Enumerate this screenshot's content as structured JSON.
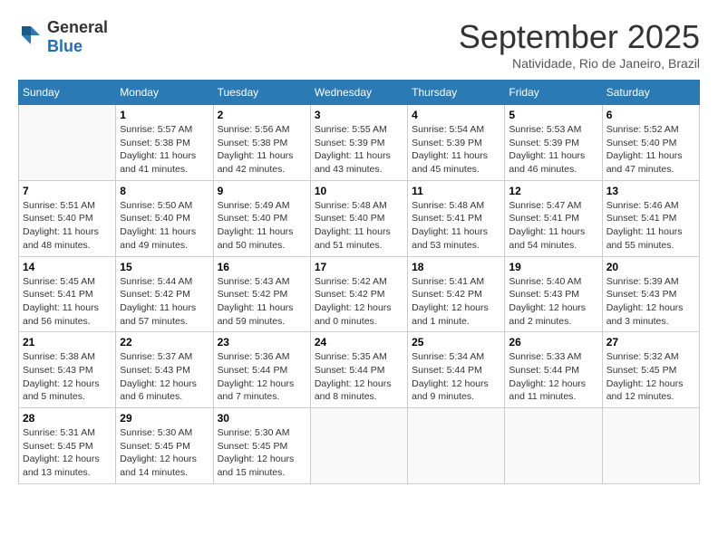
{
  "logo": {
    "general": "General",
    "blue": "Blue"
  },
  "header": {
    "month": "September 2025",
    "location": "Natividade, Rio de Janeiro, Brazil"
  },
  "weekdays": [
    "Sunday",
    "Monday",
    "Tuesday",
    "Wednesday",
    "Thursday",
    "Friday",
    "Saturday"
  ],
  "weeks": [
    [
      {
        "day": "",
        "info": ""
      },
      {
        "day": "1",
        "info": "Sunrise: 5:57 AM\nSunset: 5:38 PM\nDaylight: 11 hours\nand 41 minutes."
      },
      {
        "day": "2",
        "info": "Sunrise: 5:56 AM\nSunset: 5:38 PM\nDaylight: 11 hours\nand 42 minutes."
      },
      {
        "day": "3",
        "info": "Sunrise: 5:55 AM\nSunset: 5:39 PM\nDaylight: 11 hours\nand 43 minutes."
      },
      {
        "day": "4",
        "info": "Sunrise: 5:54 AM\nSunset: 5:39 PM\nDaylight: 11 hours\nand 45 minutes."
      },
      {
        "day": "5",
        "info": "Sunrise: 5:53 AM\nSunset: 5:39 PM\nDaylight: 11 hours\nand 46 minutes."
      },
      {
        "day": "6",
        "info": "Sunrise: 5:52 AM\nSunset: 5:40 PM\nDaylight: 11 hours\nand 47 minutes."
      }
    ],
    [
      {
        "day": "7",
        "info": "Sunrise: 5:51 AM\nSunset: 5:40 PM\nDaylight: 11 hours\nand 48 minutes."
      },
      {
        "day": "8",
        "info": "Sunrise: 5:50 AM\nSunset: 5:40 PM\nDaylight: 11 hours\nand 49 minutes."
      },
      {
        "day": "9",
        "info": "Sunrise: 5:49 AM\nSunset: 5:40 PM\nDaylight: 11 hours\nand 50 minutes."
      },
      {
        "day": "10",
        "info": "Sunrise: 5:48 AM\nSunset: 5:40 PM\nDaylight: 11 hours\nand 51 minutes."
      },
      {
        "day": "11",
        "info": "Sunrise: 5:48 AM\nSunset: 5:41 PM\nDaylight: 11 hours\nand 53 minutes."
      },
      {
        "day": "12",
        "info": "Sunrise: 5:47 AM\nSunset: 5:41 PM\nDaylight: 11 hours\nand 54 minutes."
      },
      {
        "day": "13",
        "info": "Sunrise: 5:46 AM\nSunset: 5:41 PM\nDaylight: 11 hours\nand 55 minutes."
      }
    ],
    [
      {
        "day": "14",
        "info": "Sunrise: 5:45 AM\nSunset: 5:41 PM\nDaylight: 11 hours\nand 56 minutes."
      },
      {
        "day": "15",
        "info": "Sunrise: 5:44 AM\nSunset: 5:42 PM\nDaylight: 11 hours\nand 57 minutes."
      },
      {
        "day": "16",
        "info": "Sunrise: 5:43 AM\nSunset: 5:42 PM\nDaylight: 11 hours\nand 59 minutes."
      },
      {
        "day": "17",
        "info": "Sunrise: 5:42 AM\nSunset: 5:42 PM\nDaylight: 12 hours\nand 0 minutes."
      },
      {
        "day": "18",
        "info": "Sunrise: 5:41 AM\nSunset: 5:42 PM\nDaylight: 12 hours\nand 1 minute."
      },
      {
        "day": "19",
        "info": "Sunrise: 5:40 AM\nSunset: 5:43 PM\nDaylight: 12 hours\nand 2 minutes."
      },
      {
        "day": "20",
        "info": "Sunrise: 5:39 AM\nSunset: 5:43 PM\nDaylight: 12 hours\nand 3 minutes."
      }
    ],
    [
      {
        "day": "21",
        "info": "Sunrise: 5:38 AM\nSunset: 5:43 PM\nDaylight: 12 hours\nand 5 minutes."
      },
      {
        "day": "22",
        "info": "Sunrise: 5:37 AM\nSunset: 5:43 PM\nDaylight: 12 hours\nand 6 minutes."
      },
      {
        "day": "23",
        "info": "Sunrise: 5:36 AM\nSunset: 5:44 PM\nDaylight: 12 hours\nand 7 minutes."
      },
      {
        "day": "24",
        "info": "Sunrise: 5:35 AM\nSunset: 5:44 PM\nDaylight: 12 hours\nand 8 minutes."
      },
      {
        "day": "25",
        "info": "Sunrise: 5:34 AM\nSunset: 5:44 PM\nDaylight: 12 hours\nand 9 minutes."
      },
      {
        "day": "26",
        "info": "Sunrise: 5:33 AM\nSunset: 5:44 PM\nDaylight: 12 hours\nand 11 minutes."
      },
      {
        "day": "27",
        "info": "Sunrise: 5:32 AM\nSunset: 5:45 PM\nDaylight: 12 hours\nand 12 minutes."
      }
    ],
    [
      {
        "day": "28",
        "info": "Sunrise: 5:31 AM\nSunset: 5:45 PM\nDaylight: 12 hours\nand 13 minutes."
      },
      {
        "day": "29",
        "info": "Sunrise: 5:30 AM\nSunset: 5:45 PM\nDaylight: 12 hours\nand 14 minutes."
      },
      {
        "day": "30",
        "info": "Sunrise: 5:30 AM\nSunset: 5:45 PM\nDaylight: 12 hours\nand 15 minutes."
      },
      {
        "day": "",
        "info": ""
      },
      {
        "day": "",
        "info": ""
      },
      {
        "day": "",
        "info": ""
      },
      {
        "day": "",
        "info": ""
      }
    ]
  ]
}
